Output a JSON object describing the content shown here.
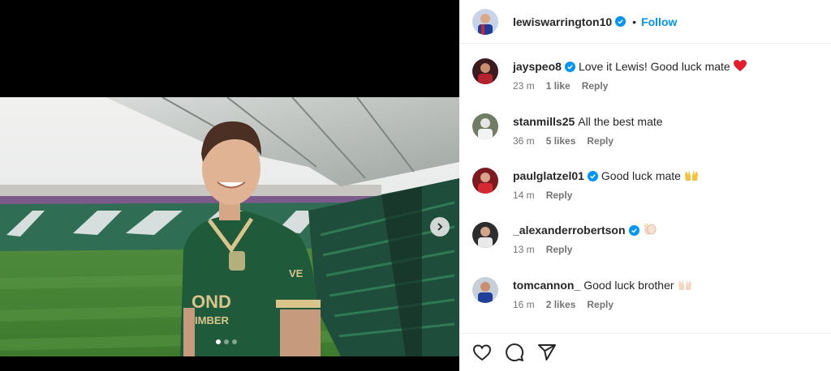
{
  "post": {
    "author": "lewiswarrington10",
    "separator": "•",
    "follow_label": "Follow",
    "carousel": {
      "total": 3,
      "active": 1
    }
  },
  "comments": [
    {
      "username": "jayspeo8",
      "verified": true,
      "text": "Love it Lewis! Good luck mate",
      "emoji": "red-heart",
      "time": "23 m",
      "likes": "1 like",
      "reply": "Reply",
      "avatar_color": "#7a1f24"
    },
    {
      "username": "stanmills25",
      "verified": false,
      "text": "All the best mate",
      "emoji": "",
      "time": "36 m",
      "likes": "5 likes",
      "reply": "Reply",
      "avatar_color": "#4b5a3c"
    },
    {
      "username": "paulglatzel01",
      "verified": true,
      "text": "Good luck mate",
      "emoji": "raising-hands",
      "time": "14 m",
      "likes": "",
      "reply": "Reply",
      "avatar_color": "#b3202a"
    },
    {
      "username": "_alexanderrobertson",
      "verified": true,
      "text": "",
      "emoji": "clapping-hands",
      "time": "13 m",
      "likes": "",
      "reply": "Reply",
      "avatar_color": "#3a3a3a"
    },
    {
      "username": "tomcannon_",
      "verified": false,
      "text": "Good luck brother",
      "emoji": "raising-hands",
      "time": "16 m",
      "likes": "2 likes",
      "reply": "Reply",
      "avatar_color": "#1f3f9a"
    }
  ],
  "colors": {
    "accent": "#0095f6",
    "verified": "#0095f6",
    "meta": "#737373",
    "jersey": "#1f5a3a"
  },
  "icons": {
    "like": "heart-icon",
    "comment": "comment-icon",
    "share": "send-icon"
  }
}
